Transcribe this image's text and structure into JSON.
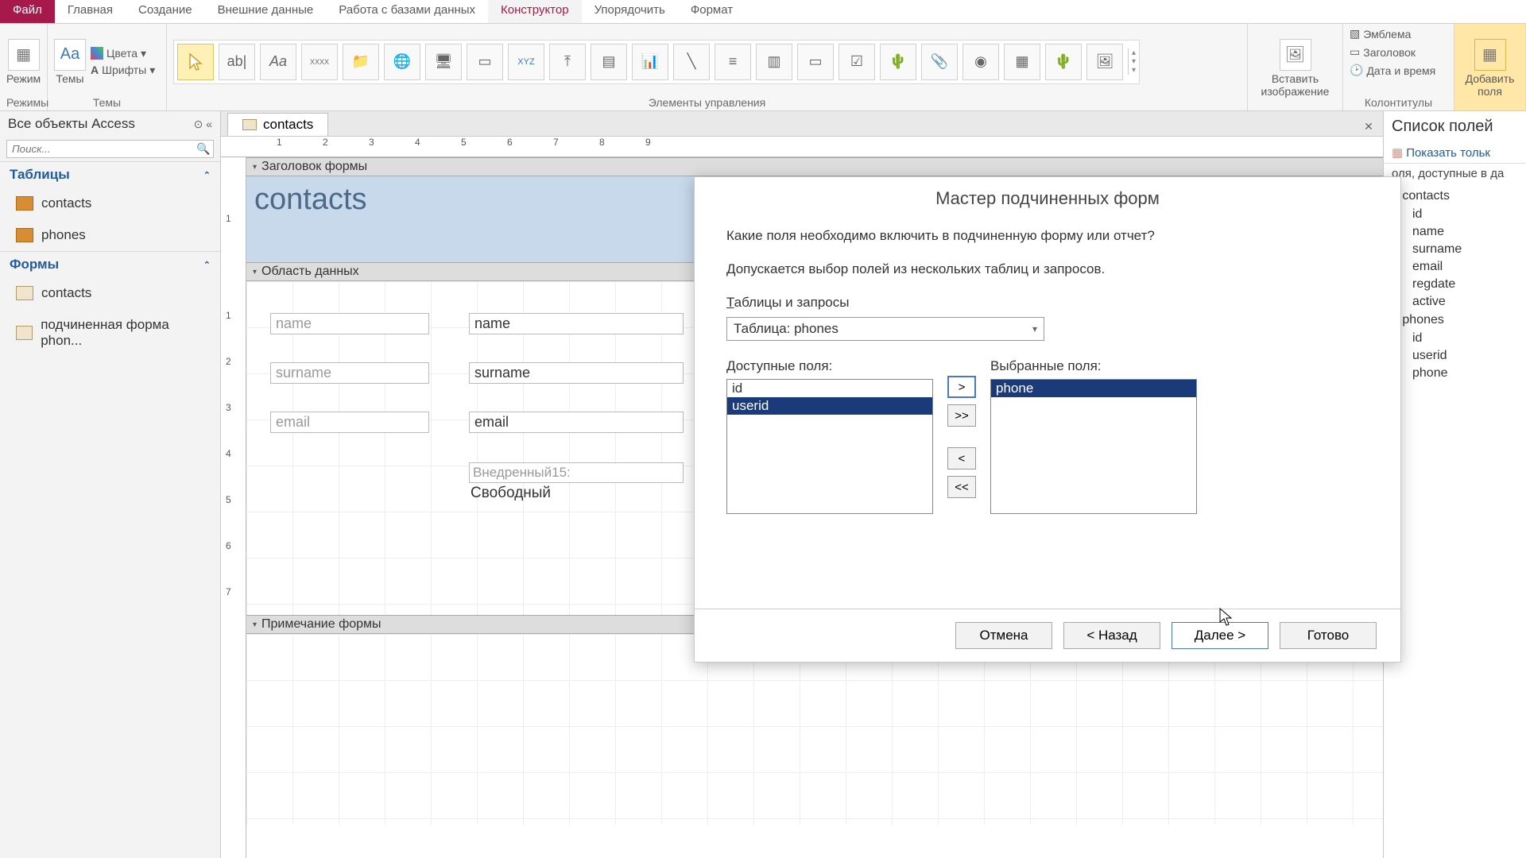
{
  "menu": {
    "file": "Файл",
    "tabs": [
      "Главная",
      "Создание",
      "Внешние данные",
      "Работа с базами данных",
      "Конструктор",
      "Упорядочить",
      "Формат"
    ],
    "active_index": 4
  },
  "ribbon": {
    "views": {
      "label": "Режимы",
      "btn": "Режим"
    },
    "themes": {
      "label": "Темы",
      "btn": "Темы",
      "colors": "Цвета",
      "fonts": "Шрифты"
    },
    "controls": {
      "label": "Элементы управления"
    },
    "insert": {
      "label": "",
      "btn": "Вставить изображение"
    },
    "headerfooter": {
      "label": "Колонтитулы",
      "logo": "Эмблема",
      "title": "Заголовок",
      "datetime": "Дата и время"
    },
    "addfields": {
      "label": "",
      "btn": "Добавить поля"
    }
  },
  "nav": {
    "title": "Все объекты Access",
    "search_placeholder": "Поиск...",
    "tables_header": "Таблицы",
    "forms_header": "Формы",
    "tables": [
      "contacts",
      "phones"
    ],
    "forms": [
      "contacts",
      "подчиненная форма phon..."
    ]
  },
  "document": {
    "tab": "contacts",
    "header_section": "Заголовок формы",
    "detail_section": "Область данных",
    "footer_section": "Примечание формы",
    "title_text": "contacts",
    "fields": [
      {
        "label": "name",
        "control": "name"
      },
      {
        "label": "surname",
        "control": "surname"
      },
      {
        "label": "email",
        "control": "email"
      }
    ],
    "embed_label": "Внедренный15:",
    "embed_text": "Свободный",
    "ruler_numbers": [
      "1",
      "2",
      "3",
      "4",
      "5",
      "6",
      "7",
      "8",
      "9"
    ],
    "vruler_header": [
      "1"
    ],
    "vruler_detail": [
      "1",
      "2",
      "3",
      "4",
      "5",
      "6",
      "7"
    ]
  },
  "wizard": {
    "title": "Мастер подчиненных форм",
    "q1": "Какие поля необходимо включить в подчиненную форму или отчет?",
    "q2": "Допускается выбор полей из нескольких таблиц и запросов.",
    "tables_label": "Таблицы и запросы",
    "combo_value": "Таблица: phones",
    "available_label": "Доступные поля:",
    "selected_label": "Выбранные поля:",
    "available": [
      {
        "name": "id",
        "selected": false
      },
      {
        "name": "userid",
        "selected": true
      }
    ],
    "selected": [
      {
        "name": "phone",
        "selected": true
      }
    ],
    "move": {
      "add": ">",
      "addall": ">>",
      "remove": "<",
      "removeall": "<<"
    },
    "buttons": {
      "cancel": "Отмена",
      "back": "< Назад",
      "next": "Далее >",
      "finish": "Готово"
    }
  },
  "fieldlist": {
    "title": "Список полей",
    "show_all": "Показать тольк",
    "available_in": "оля, доступные в да",
    "tree": [
      {
        "table": "contacts",
        "fields": [
          "id",
          "name",
          "surname",
          "email",
          "regdate",
          "active"
        ]
      },
      {
        "table": "phones",
        "fields": [
          "id",
          "userid",
          "phone"
        ]
      }
    ]
  }
}
